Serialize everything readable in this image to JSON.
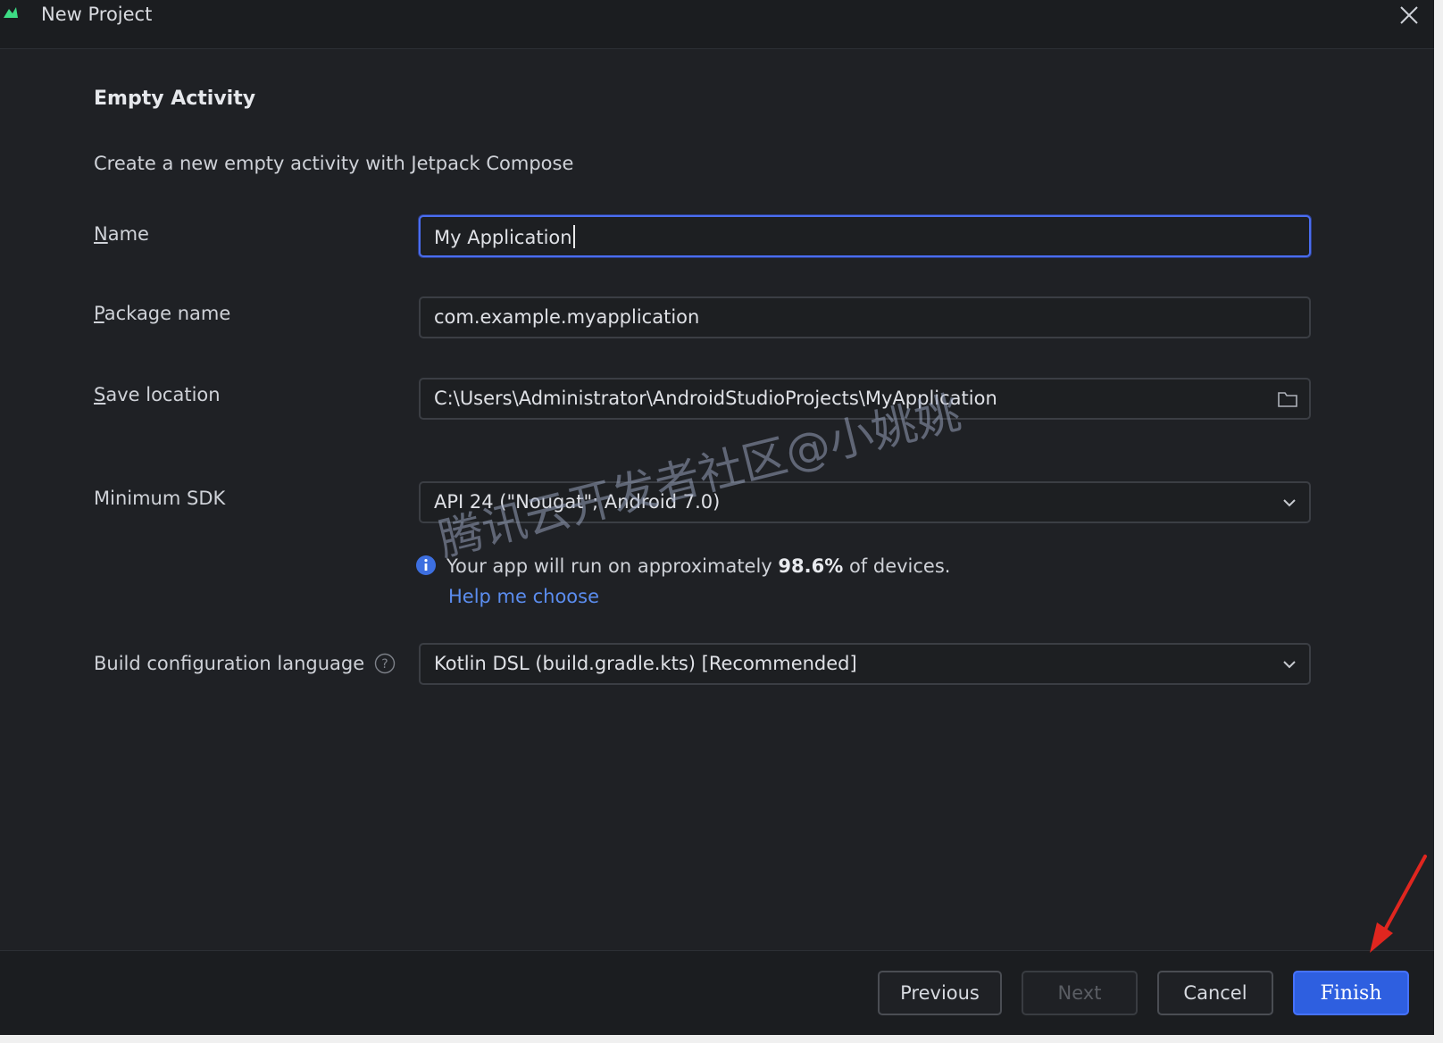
{
  "window": {
    "title": "New Project",
    "close_glyph": "✕"
  },
  "page": {
    "heading": "Empty Activity",
    "description": "Create a new empty activity with Jetpack Compose"
  },
  "fields": {
    "name": {
      "label_mnemonic": "N",
      "label_rest": "ame",
      "value": "My Application"
    },
    "package": {
      "label_mnemonic": "P",
      "label_rest": "ackage name",
      "value": "com.example.myapplication"
    },
    "save_location": {
      "label_mnemonic": "S",
      "label_rest": "ave location",
      "value": "C:\\Users\\Administrator\\AndroidStudioProjects\\MyApplication",
      "icon": "folder-icon"
    },
    "min_sdk": {
      "label": "Minimum SDK",
      "value": "API 24 (\"Nougat\"; Android 7.0)"
    },
    "build_language": {
      "label": "Build configuration language",
      "value": "Kotlin DSL (build.gradle.kts) [Recommended]"
    }
  },
  "sdk_info": {
    "prefix": "Your app will run on approximately ",
    "percent": "98.6%",
    "suffix": " of devices.",
    "help_link": "Help me choose"
  },
  "buttons": {
    "previous": "Previous",
    "next": "Next",
    "cancel": "Cancel",
    "finish": "Finish"
  },
  "watermark": "腾讯云开发者社区@小姚姚",
  "colors": {
    "background": "#1f2125",
    "accent": "#2e5fe0",
    "focus_border": "#4a6df0",
    "link": "#5b8def",
    "annotation_arrow": "#e0261f"
  }
}
